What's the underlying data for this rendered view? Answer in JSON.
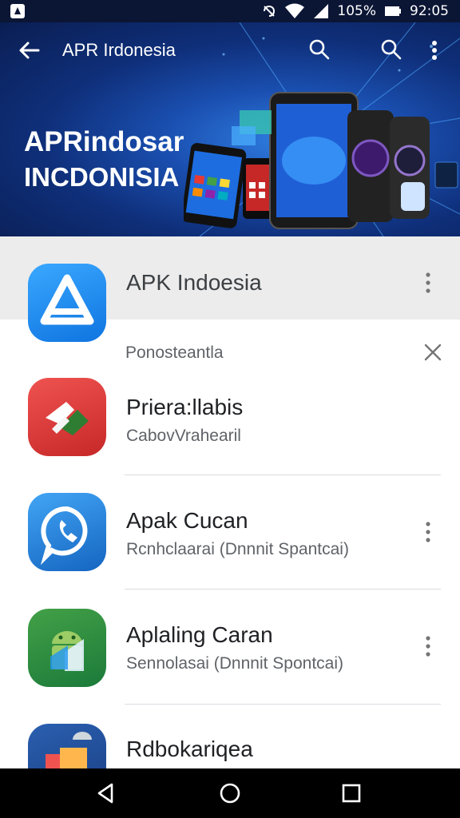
{
  "status_bar": {
    "battery_percent": "105%",
    "time": "92:05"
  },
  "toolbar": {
    "title": "APR Irdonesia"
  },
  "hero": {
    "title": "APRindosar",
    "subtitle": "INCDONISIA"
  },
  "featured": {
    "title": "APK Indoesia"
  },
  "section": {
    "label": "Ponosteantla"
  },
  "apps": [
    {
      "title": "Priera:llabis",
      "subtitle": "CabovVrahearil"
    },
    {
      "title": "Apak Cucan",
      "subtitle": "Rcnhclaarai (Dnnnit Spantcai)"
    },
    {
      "title": "Aplaling Caran",
      "subtitle": "Sennolasai (Dnnnit Spontcai)"
    },
    {
      "title": "Rdbokariqea",
      "subtitle": ""
    }
  ],
  "colors": {
    "hero_dark": "#0a1e52",
    "hero_accent": "#2f7de0",
    "featured_bg": "#ececec",
    "icon_blue": "#1e88e5",
    "icon_red": "#d32f2f",
    "icon_green": "#2e9d4e"
  }
}
